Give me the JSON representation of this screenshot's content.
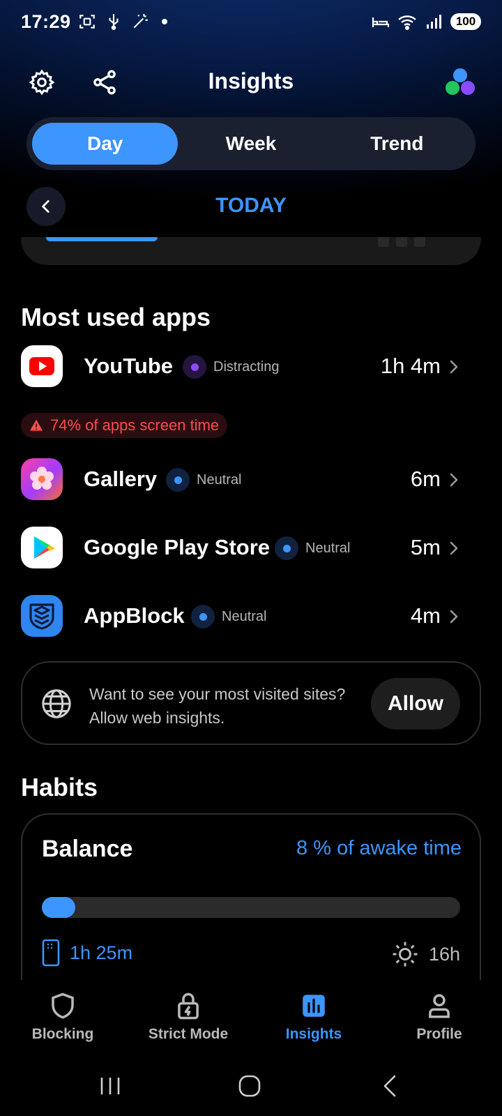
{
  "status_bar": {
    "time": "17:29",
    "battery": "100",
    "icons": [
      "screenshot-icon",
      "usb-icon",
      "magic-wand-icon",
      "notification-dot",
      "sleep-icon",
      "wifi-icon",
      "signal-icon",
      "battery-icon"
    ]
  },
  "header": {
    "title": "Insights",
    "icons": [
      "gear-icon",
      "share-icon",
      "app-logo"
    ],
    "logo_colors": [
      "#3d95ff",
      "#22c55e",
      "#8a4cff"
    ]
  },
  "tabs": [
    {
      "label": "Day",
      "active": true
    },
    {
      "label": "Week",
      "active": false
    },
    {
      "label": "Trend",
      "active": false
    }
  ],
  "date_nav": {
    "label": "TODAY"
  },
  "most_used": {
    "title": "Most used apps",
    "apps": [
      {
        "name": "YouTube",
        "category": "Distracting",
        "time": "1h 4m",
        "icon": "youtube-icon"
      },
      {
        "name": "Gallery",
        "category": "Neutral",
        "time": "6m",
        "icon": "gallery-icon"
      },
      {
        "name": "Google Play Store",
        "category": "Neutral",
        "time": "5m",
        "icon": "play-store-icon"
      },
      {
        "name": "AppBlock",
        "category": "Neutral",
        "time": "4m",
        "icon": "appblock-icon"
      }
    ],
    "warning": "74% of apps screen time"
  },
  "web_insights": {
    "text": "Want to see your most visited sites? Allow web insights.",
    "button": "Allow"
  },
  "habits": {
    "title": "Habits",
    "balance": {
      "title": "Balance",
      "percent_text": "8 % of awake time",
      "fraction": 0.08,
      "phone_time": "1h 25m",
      "awake_time": "16h"
    }
  },
  "bottom_nav": [
    {
      "label": "Blocking",
      "icon": "shield-icon",
      "active": false
    },
    {
      "label": "Strict Mode",
      "icon": "lock-bolt-icon",
      "active": false
    },
    {
      "label": "Insights",
      "icon": "chart-icon",
      "active": true
    },
    {
      "label": "Profile",
      "icon": "profile-icon",
      "active": false
    }
  ],
  "colors": {
    "accent": "#3d95ff",
    "distracting": "#8a4cff",
    "warning": "#ff4a4a",
    "background": "#000000"
  }
}
